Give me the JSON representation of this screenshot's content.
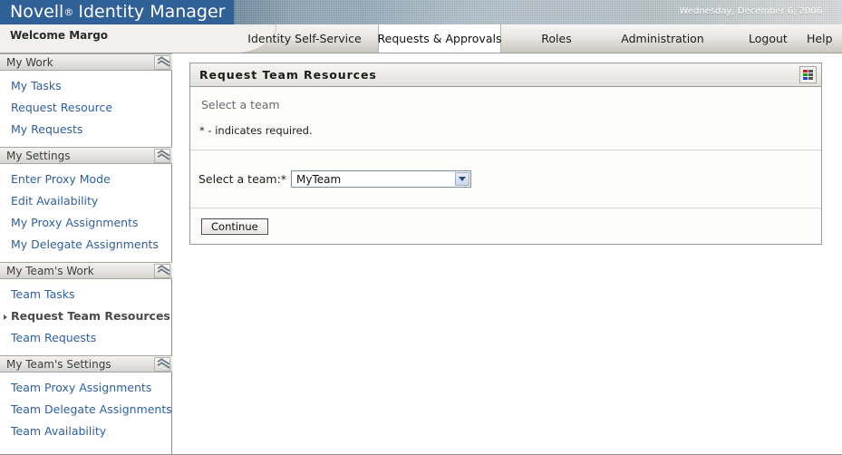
{
  "header": {
    "brand_name": "Novell",
    "brand_reg": "®",
    "product_name": "Identity Manager",
    "date": "Wednesday, December 6, 2006",
    "brand_blue": "#2f6096"
  },
  "welcome": {
    "text": "Welcome Margo"
  },
  "tabs": [
    {
      "label": "Identity Self-Service",
      "active": false
    },
    {
      "label": "Requests & Approvals",
      "active": true
    },
    {
      "label": "Roles",
      "active": false
    },
    {
      "label": "Administration",
      "active": false
    }
  ],
  "account_links": [
    {
      "label": "Logout"
    },
    {
      "label": "Help"
    }
  ],
  "sidebar": {
    "sections": [
      {
        "title": "My Work",
        "collapse_icon": "chevron-up-double-icon",
        "items": [
          {
            "label": "My Tasks",
            "selected": false
          },
          {
            "label": "Request Resource",
            "selected": false
          },
          {
            "label": "My Requests",
            "selected": false
          }
        ]
      },
      {
        "title": "My Settings",
        "collapse_icon": "chevron-up-double-icon",
        "items": [
          {
            "label": "Enter Proxy Mode",
            "selected": false
          },
          {
            "label": "Edit Availability",
            "selected": false
          },
          {
            "label": "My Proxy Assignments",
            "selected": false
          },
          {
            "label": "My Delegate Assignments",
            "selected": false
          }
        ]
      },
      {
        "title": "My Team's Work",
        "collapse_icon": "chevron-up-double-icon",
        "items": [
          {
            "label": "Team Tasks",
            "selected": false
          },
          {
            "label": "Request Team Resources",
            "selected": true
          },
          {
            "label": "Team Requests",
            "selected": false
          }
        ]
      },
      {
        "title": "My Team's Settings",
        "collapse_icon": "chevron-up-double-icon",
        "items": [
          {
            "label": "Team Proxy Assignments",
            "selected": false
          },
          {
            "label": "Team Delegate Assignments",
            "selected": false
          },
          {
            "label": "Team Availability",
            "selected": false
          }
        ]
      }
    ],
    "link_color": "#2f5f9e",
    "selected_color": "#4a4a4a"
  },
  "panel": {
    "title": "Request Team Resources",
    "icon": "grid-view-icon",
    "icon_colors": [
      "#cc2222",
      "#4a4a4a",
      "#1a9a1a",
      "#4a4a4a",
      "#2244cc",
      "#4a4a4a"
    ],
    "section_caption": "Select a team",
    "required_note": "* - indicates required.",
    "form": {
      "field_label": "Select a team:*",
      "select_name": "team-select",
      "select_value": "MyTeam",
      "select_options": [
        "MyTeam"
      ],
      "dropdown_icon": "chevron-down-icon"
    },
    "continue_label": "Continue"
  }
}
